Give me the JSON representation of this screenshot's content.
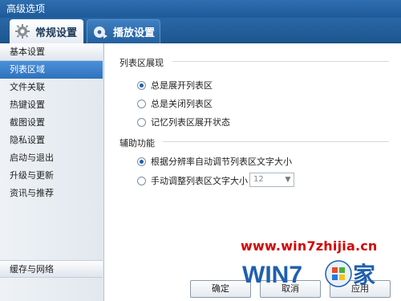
{
  "window": {
    "title": "高级选项"
  },
  "tabs": [
    {
      "label": "常规设置",
      "icon": "gear-icon",
      "active": true
    },
    {
      "label": "播放设置",
      "icon": "play-settings-icon",
      "active": false
    }
  ],
  "sidebar": {
    "header": "基本设置",
    "items": [
      {
        "label": "列表区域",
        "active": true
      },
      {
        "label": "文件关联"
      },
      {
        "label": "热键设置"
      },
      {
        "label": "截图设置"
      },
      {
        "label": "隐私设置"
      },
      {
        "label": "启动与退出"
      },
      {
        "label": "升级与更新"
      },
      {
        "label": "资讯与推荐"
      }
    ],
    "bottom": "缓存与网络"
  },
  "section1": {
    "title": "列表区展现",
    "options": [
      {
        "label": "总是展开列表区",
        "checked": true
      },
      {
        "label": "总是关闭列表区",
        "checked": false
      },
      {
        "label": "记忆列表区展开状态",
        "checked": false
      }
    ]
  },
  "section2": {
    "title": "辅助功能",
    "options": [
      {
        "label": "根据分辨率自动调节列表区文字大小",
        "checked": true
      },
      {
        "label": "手动调整列表区文字大小",
        "checked": false
      }
    ],
    "font_size_select": "12"
  },
  "buttons": {
    "ok": "确定",
    "cancel": "取消",
    "apply": "应用"
  },
  "watermark": {
    "url": "www.win7zhijia.cn",
    "logo_text": "WIN7",
    "logo_suffix": "家"
  },
  "colors": {
    "titlebar": "#2f6eb0",
    "active_item": "#3a7fcc",
    "watermark_red": "#d40000"
  }
}
